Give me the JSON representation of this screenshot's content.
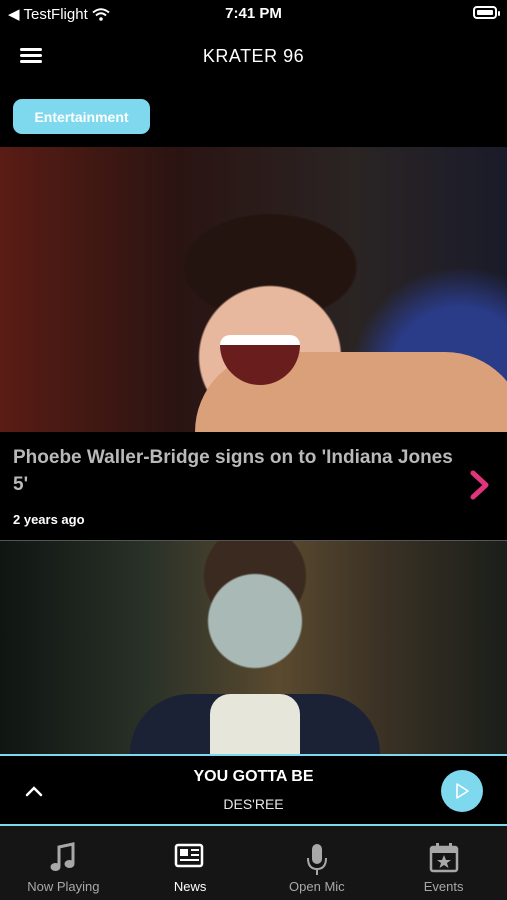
{
  "status_bar": {
    "back_app": "TestFlight",
    "time": "7:41 PM",
    "battery_level": 0.9
  },
  "header": {
    "title": "KRATER 96"
  },
  "category": {
    "label": "Entertainment"
  },
  "articles": [
    {
      "title": "Phoebe Waller-Bridge signs on to 'Indiana Jones 5'",
      "time_ago": "2 years ago"
    }
  ],
  "player": {
    "song": "YOU GOTTA BE",
    "artist": "DES'REE"
  },
  "tabs": [
    {
      "label": "Now Playing",
      "icon": "music-note-icon"
    },
    {
      "label": "News",
      "icon": "newspaper-icon"
    },
    {
      "label": "Open Mic",
      "icon": "microphone-icon"
    },
    {
      "label": "Events",
      "icon": "calendar-star-icon"
    }
  ],
  "colors": {
    "accent": "#7fd9ee",
    "chevron": "#e0357c"
  }
}
